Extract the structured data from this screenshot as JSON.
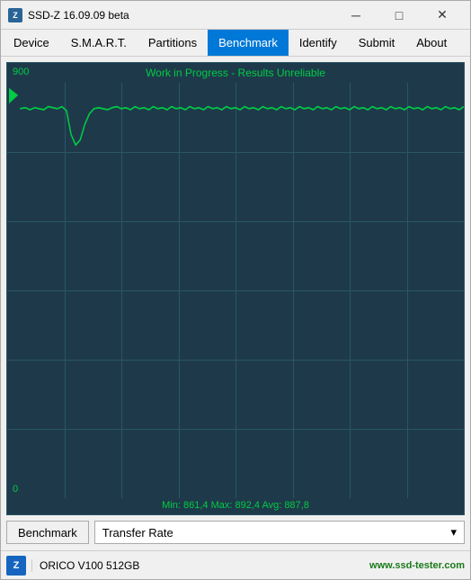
{
  "window": {
    "title": "SSD-Z 16.09.09 beta",
    "icon_label": "Z",
    "controls": {
      "minimize": "─",
      "maximize": "□",
      "close": "✕"
    }
  },
  "menubar": {
    "items": [
      {
        "id": "device",
        "label": "Device",
        "active": false
      },
      {
        "id": "smart",
        "label": "S.M.A.R.T.",
        "active": false
      },
      {
        "id": "partitions",
        "label": "Partitions",
        "active": false
      },
      {
        "id": "benchmark",
        "label": "Benchmark",
        "active": true
      },
      {
        "id": "identify",
        "label": "Identify",
        "active": false
      },
      {
        "id": "submit",
        "label": "Submit",
        "active": false
      },
      {
        "id": "about",
        "label": "About",
        "active": false
      }
    ]
  },
  "chart": {
    "title": "Work in Progress - Results Unreliable",
    "y_max": "900",
    "y_min": "0",
    "stats": "Min: 861,4   Max: 892,4   Avg: 887,8",
    "accent_color": "#00cc44",
    "bg_color": "#1e3a4a",
    "grid_color": "#2a5566"
  },
  "controls": {
    "benchmark_btn": "Benchmark",
    "dropdown_value": "Transfer Rate",
    "dropdown_arrow": "▾"
  },
  "statusbar": {
    "icon_label": "Z",
    "device_name": "ORICO V100  512GB",
    "website": "www.ssd-tester.com"
  }
}
